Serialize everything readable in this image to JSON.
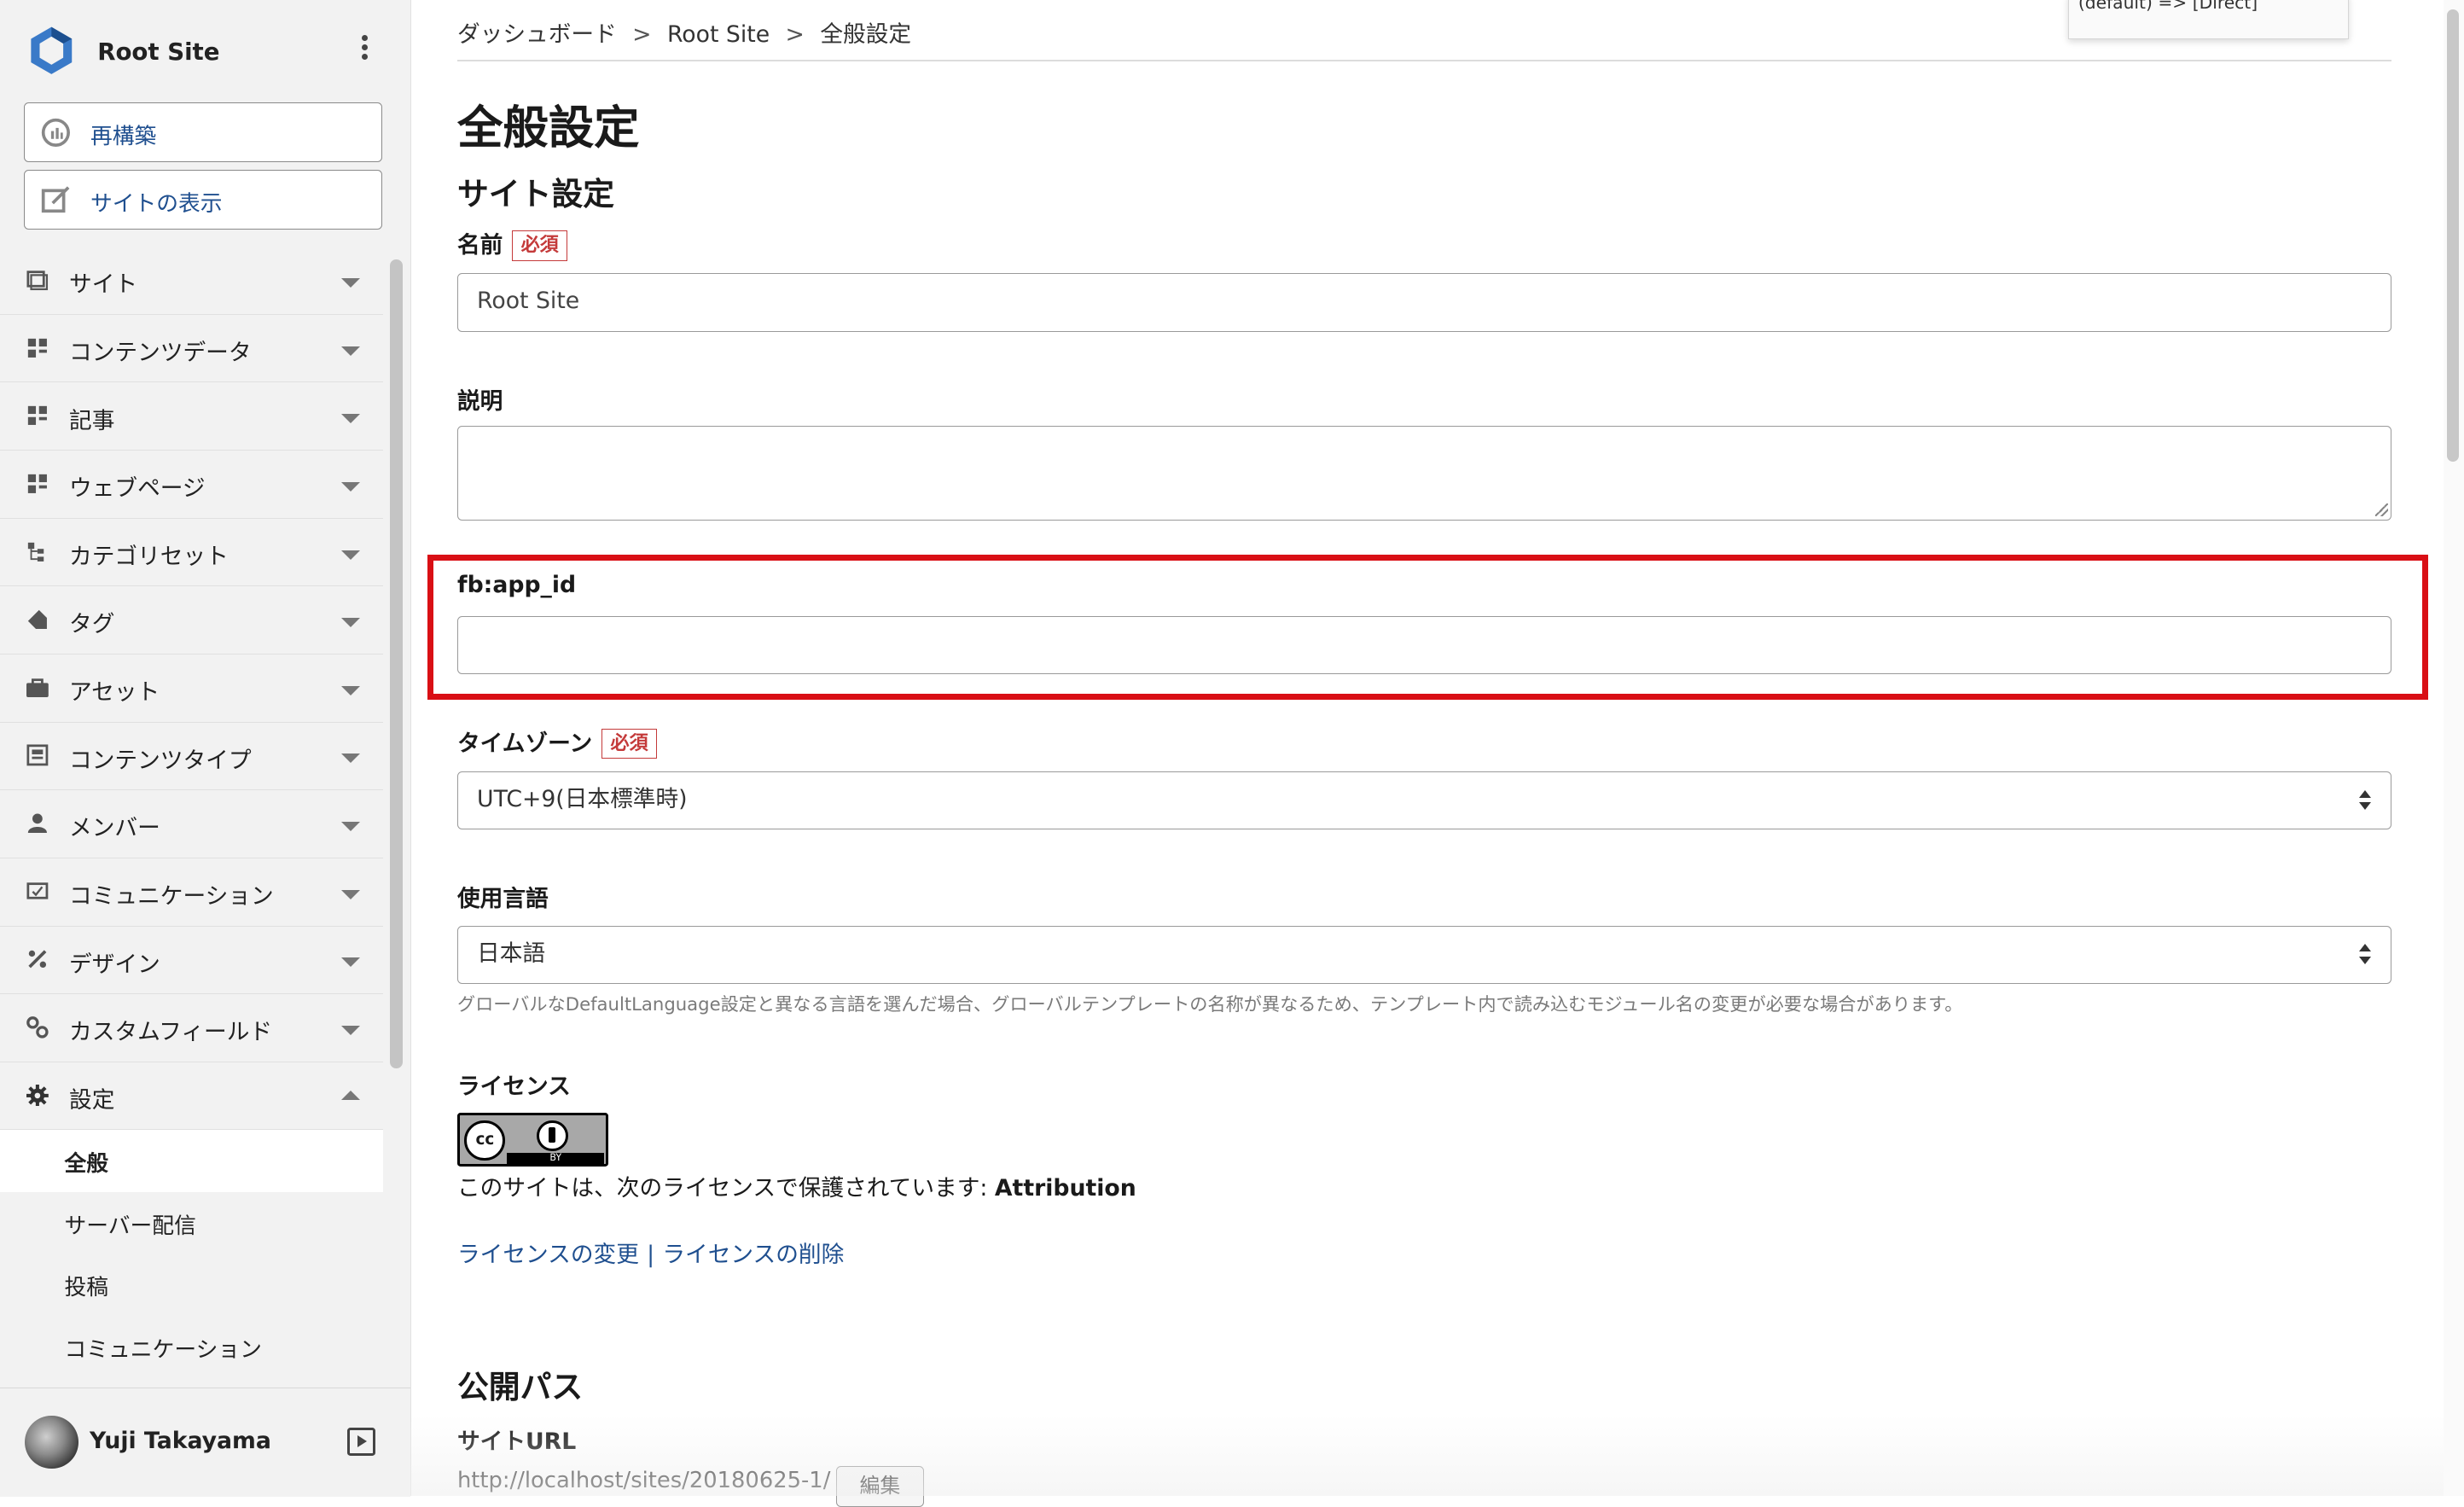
{
  "sidebar": {
    "site_name": "Root Site",
    "buttons": [
      {
        "label": "再構築",
        "icon": "rebuild-icon"
      },
      {
        "label": "サイトの表示",
        "icon": "view-site-icon"
      }
    ],
    "items": [
      {
        "label": "サイト",
        "icon": "site-icon",
        "expanded": false
      },
      {
        "label": "コンテンツデータ",
        "icon": "content-data-icon",
        "expanded": false
      },
      {
        "label": "記事",
        "icon": "entry-icon",
        "expanded": false
      },
      {
        "label": "ウェブページ",
        "icon": "webpage-icon",
        "expanded": false
      },
      {
        "label": "カテゴリセット",
        "icon": "category-set-icon",
        "expanded": false
      },
      {
        "label": "タグ",
        "icon": "tag-icon",
        "expanded": false
      },
      {
        "label": "アセット",
        "icon": "asset-icon",
        "expanded": false
      },
      {
        "label": "コンテンツタイプ",
        "icon": "content-type-icon",
        "expanded": false
      },
      {
        "label": "メンバー",
        "icon": "member-icon",
        "expanded": false
      },
      {
        "label": "コミュニケーション",
        "icon": "communication-icon",
        "expanded": false
      },
      {
        "label": "デザイン",
        "icon": "design-icon",
        "expanded": false
      },
      {
        "label": "カスタムフィールド",
        "icon": "custom-field-icon",
        "expanded": false
      },
      {
        "label": "設定",
        "icon": "gear-icon",
        "expanded": true
      }
    ],
    "sub_items": [
      {
        "label": "全般",
        "active": true
      },
      {
        "label": "サーバー配信",
        "active": false
      },
      {
        "label": "投稿",
        "active": false
      },
      {
        "label": "コミュニケーション",
        "active": false
      }
    ],
    "user_name": "Yuji Takayama"
  },
  "breadcrumb": [
    "ダッシュボード",
    "Root Site",
    "全般設定"
  ],
  "breadcrumb_separator": ">",
  "page_title": "全般設定",
  "section_site_settings": "サイト設定",
  "required_label": "必須",
  "fields": {
    "name": {
      "label": "名前",
      "value": "Root Site"
    },
    "description": {
      "label": "説明",
      "value": ""
    },
    "fb_app_id": {
      "label": "fb:app_id",
      "value": ""
    },
    "timezone": {
      "label": "タイムゾーン",
      "value": "UTC+9(日本標準時)"
    },
    "language": {
      "label": "使用言語",
      "value": "日本語",
      "hint": "グローバルなDefaultLanguage設定と異なる言語を選んだ場合、グローバルテンプレートの名称が異なるため、テンプレート内で読み込むモジュール名の変更が必要な場合があります。"
    },
    "license": {
      "label": "ライセンス",
      "badge_cc": "cc",
      "badge_by": "BY",
      "text_prefix": "このサイトは、次のライセンスで保護されています: ",
      "text_name": "Attribution",
      "change_link": "ライセンスの変更",
      "link_separator": "|",
      "delete_link": "ライセンスの削除"
    }
  },
  "section_publish_path": "公開パス",
  "site_url": {
    "label": "サイトURL",
    "value": "http://localhost/sites/20180625-1/",
    "edit_label": "編集"
  },
  "float_card_text": "(default) => [Direct]",
  "highlight_color": "#d90f15",
  "link_color": "#1f4f8f"
}
